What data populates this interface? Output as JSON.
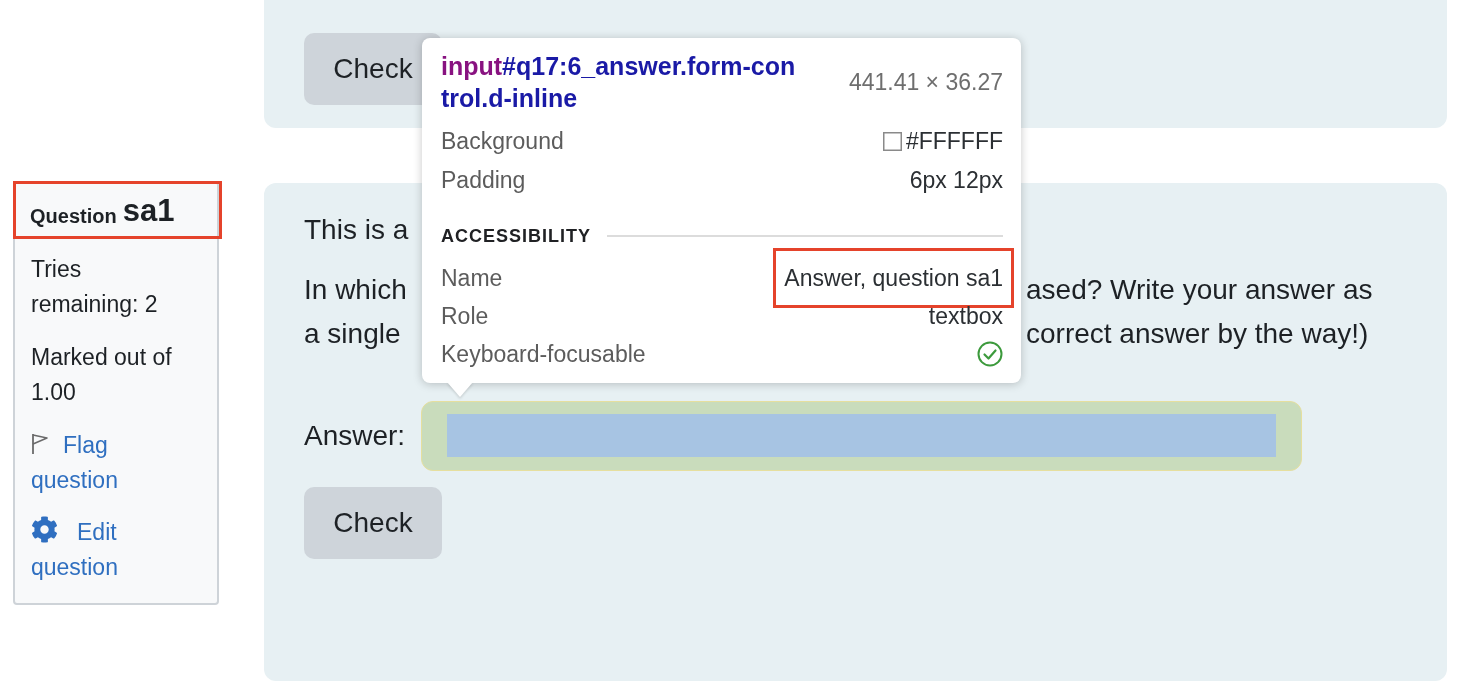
{
  "top_card": {
    "check_button": "Check"
  },
  "question_info": {
    "highlighted": true,
    "label": "Question",
    "number": "sa1",
    "tries": "Tries remaining: 2",
    "marks": "Marked out of 1.00",
    "links": [
      {
        "kind": "flag",
        "label": "Flag question"
      },
      {
        "kind": "edit",
        "label": "Edit question"
      }
    ]
  },
  "question": {
    "paragraphs": [
      {
        "lines": [
          {
            "left": "This is a"
          }
        ]
      },
      {
        "lines": [
          {
            "left": "In which",
            "right": "ased? Write your answer as"
          },
          {
            "left": "a single",
            "right": "correct answer by the way!)"
          }
        ]
      }
    ],
    "answer_label": "Answer:",
    "answer_field": {
      "highlighted": true
    },
    "check_button": "Check"
  },
  "inspector_tooltip": {
    "tag": "input",
    "selector": "#q17:6_answer.form-control.d-inline",
    "size": "441.41 × 36.27",
    "properties": [
      {
        "kind": "swatch",
        "label": "Background",
        "value": "#FFFFFF"
      },
      {
        "kind": "text",
        "label": "Padding",
        "value": "6px 12px"
      }
    ],
    "section": "ACCESSIBILITY",
    "accessibility": [
      {
        "kind": "text",
        "label": "Name",
        "value": "Answer, question sa1",
        "highlighted": true
      },
      {
        "kind": "text",
        "label": "Role",
        "value": "textbox",
        "highlighted": false
      },
      {
        "kind": "check",
        "label": "Keyboard-focusable",
        "checked": true
      }
    ]
  }
}
